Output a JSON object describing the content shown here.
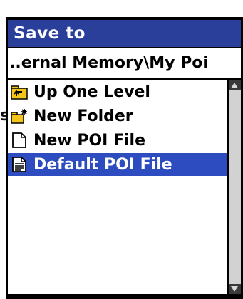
{
  "stray_text": "s",
  "dialog": {
    "title": "Save to",
    "path": "..ernal Memory\\My Poi",
    "items": [
      {
        "label": "Up One Level",
        "icon": "up-folder-icon",
        "selected": false
      },
      {
        "label": "New Folder",
        "icon": "new-folder-icon",
        "selected": false
      },
      {
        "label": "New POI File",
        "icon": "new-file-icon",
        "selected": false
      },
      {
        "label": "Default POI File",
        "icon": "document-icon",
        "selected": true
      }
    ]
  },
  "colors": {
    "title_bar": "#2a3f9a",
    "selection": "#2d4cc0",
    "folder": "#f3c51a",
    "frame": "#000000"
  }
}
